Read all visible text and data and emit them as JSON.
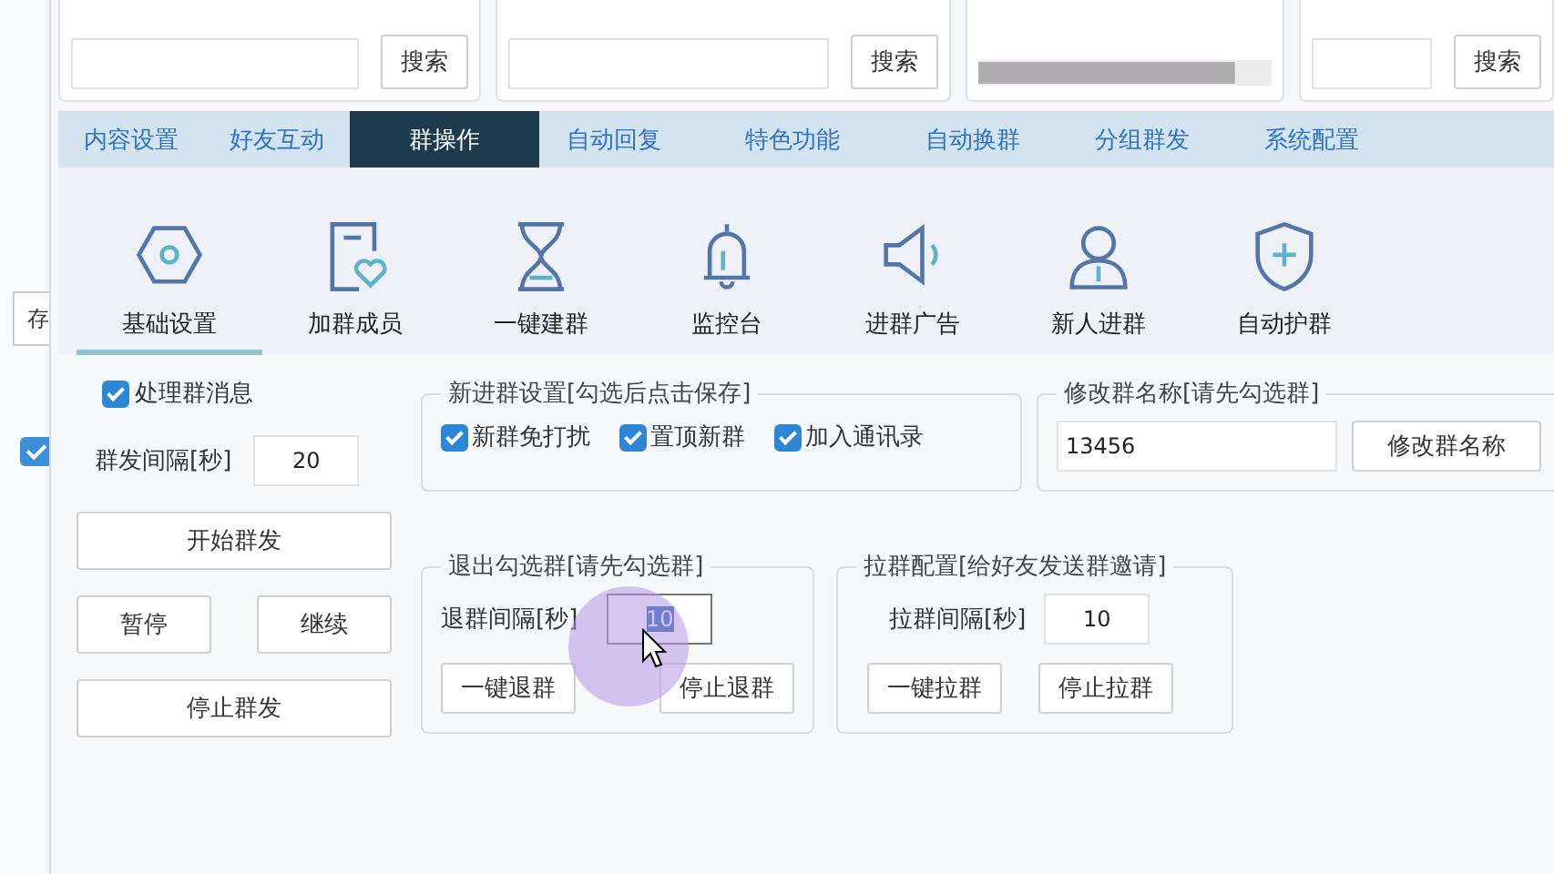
{
  "top_panels": [
    {
      "kind": "search",
      "button": "搜索"
    },
    {
      "kind": "search",
      "button": "搜索"
    },
    {
      "kind": "grid"
    },
    {
      "kind": "search",
      "button": "搜索"
    }
  ],
  "left_strip": {
    "button": "存",
    "checkbox": {
      "checked": true
    }
  },
  "tabs": [
    {
      "label": "内容设置",
      "selected": false
    },
    {
      "label": "好友互动",
      "selected": false
    },
    {
      "label": "群操作",
      "selected": true
    },
    {
      "label": "自动回复",
      "selected": false
    },
    {
      "label": "特色功能",
      "selected": false
    },
    {
      "label": "自动换群",
      "selected": false
    },
    {
      "label": "分组群发",
      "selected": false
    },
    {
      "label": "系统配置",
      "selected": false
    }
  ],
  "tools": [
    {
      "label": "基础设置",
      "selected": true
    },
    {
      "label": "加群成员",
      "selected": false
    },
    {
      "label": "一键建群",
      "selected": false
    },
    {
      "label": "监控台",
      "selected": false
    },
    {
      "label": "进群广告",
      "selected": false
    },
    {
      "label": "新人进群",
      "selected": false
    },
    {
      "label": "自动护群",
      "selected": false
    }
  ],
  "mass_send": {
    "process_messages": {
      "label": "处理群消息",
      "checked": true
    },
    "interval_label": "群发间隔[秒]",
    "interval_value": "20",
    "start": "开始群发",
    "pause": "暂停",
    "resume": "继续",
    "stop": "停止群发"
  },
  "new_group": {
    "title": "新进群设置[勾选后点击保存]",
    "options": [
      {
        "label": "新群免打扰",
        "checked": true
      },
      {
        "label": "置顶新群",
        "checked": true
      },
      {
        "label": "加入通讯录",
        "checked": true
      }
    ]
  },
  "rename": {
    "title": "修改群名称[请先勾选群]",
    "value": "13456",
    "button": "修改群名称"
  },
  "quit": {
    "title": "退出勾选群[请先勾选群]",
    "interval_label": "退群间隔[秒]",
    "interval_value": "10",
    "value_selected": true,
    "buttons": [
      "一键退群",
      "停止退群"
    ]
  },
  "pull": {
    "title": "拉群配置[给好友发送群邀请]",
    "interval_label": "拉群间隔[秒]",
    "interval_value": "10",
    "buttons": [
      "一键拉群",
      "停止拉群"
    ]
  }
}
